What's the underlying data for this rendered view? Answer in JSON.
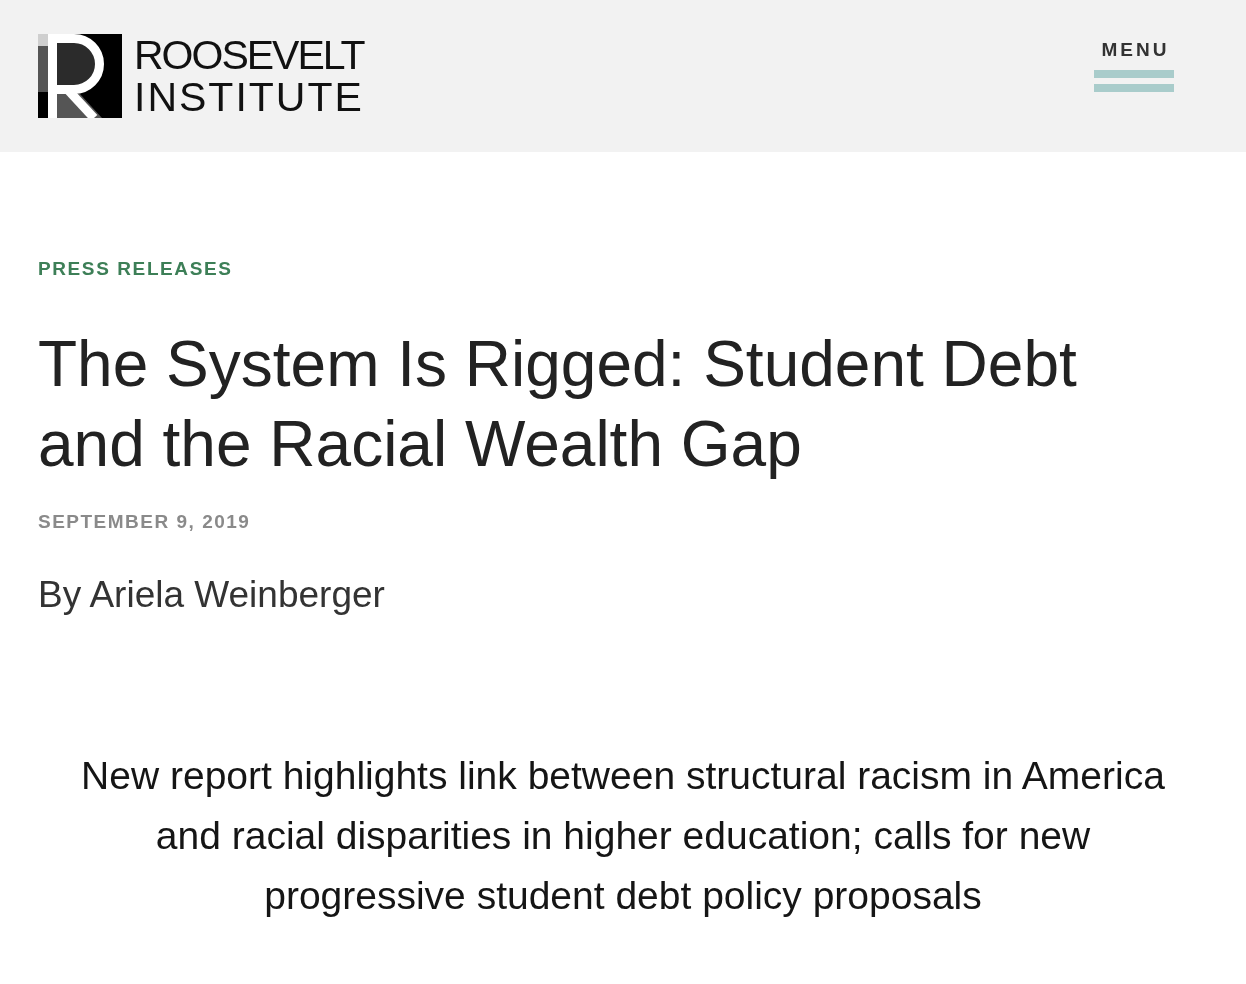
{
  "header": {
    "logo": {
      "line_1": "ROOSEVELT",
      "line_2": "INSTITUTE"
    },
    "menu_button": {
      "label": "MENU"
    }
  },
  "article": {
    "category": "PRESS RELEASES",
    "title": "The System Is Rigged: Student Debt and the Racial Wealth Gap",
    "date": "SEPTEMBER 9, 2019",
    "byline": "By Ariela Weinberger",
    "subtitle": "New report highlights link between structural racism in America and racial disparities in higher education; calls for new progressive student debt policy proposals"
  }
}
